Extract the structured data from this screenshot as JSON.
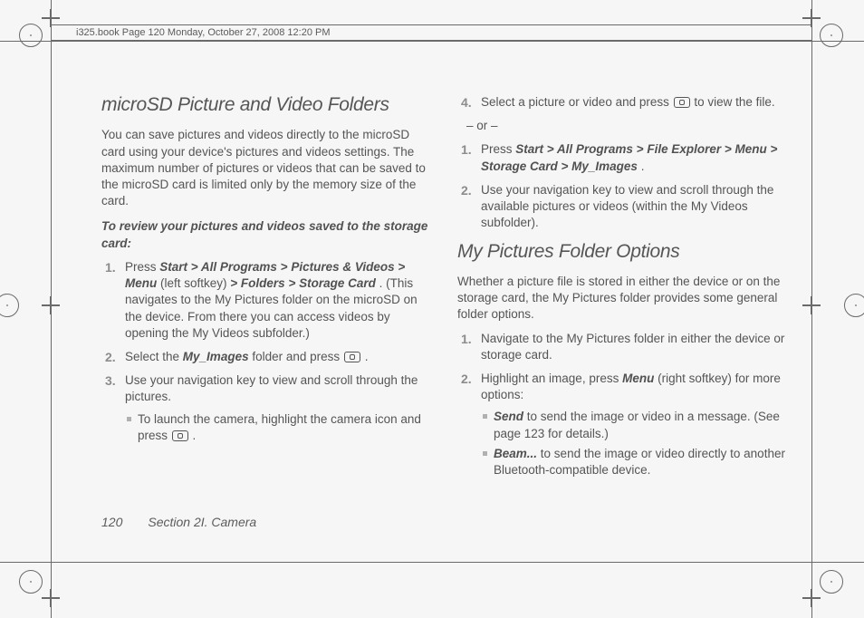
{
  "header": "i325.book  Page 120  Monday, October 27, 2008  12:20 PM",
  "left": {
    "h2": "microSD Picture and Video Folders",
    "intro": "You can save pictures and videos directly to the microSD card using your device's pictures and videos settings. The maximum number of pictures or videos that can be saved to the microSD card is limited only by the memory size of the card.",
    "sub": "To review your pictures and videos saved to the storage card:",
    "li1_a": "Press ",
    "li1_path": "Start > All Programs > Pictures & Videos > Menu",
    "li1_b": " (left softkey) ",
    "li1_path2": "> Folders > Storage Card",
    "li1_c": ". (This navigates to the My Pictures folder on the microSD on the device. From there you can access videos by opening the My Videos subfolder.)",
    "li2_a": "Select the ",
    "li2_em": "My_Images",
    "li2_b": " folder and press ",
    "li2_c": ".",
    "li3": "Use your navigation key to view and scroll through the pictures.",
    "li3_sub_a": "To launch the camera, highlight the camera icon and press ",
    "li3_sub_b": "."
  },
  "right": {
    "li4_a": "Select a picture or video and press ",
    "li4_b": " to view the file.",
    "or": "– or –",
    "li1_a": "Press ",
    "li1_path": "Start > All Programs > File Explorer > Menu > Storage Card > My_Images",
    "li1_b": ".",
    "li2": "Use your navigation key to view and scroll through the available pictures or videos (within the My Videos subfolder).",
    "h2": "My Pictures Folder Options",
    "intro": "Whether a picture file is stored in either the device or on the storage card, the My Pictures folder provides some general folder options.",
    "b_li1": "Navigate to the My Pictures folder in either the device or storage card.",
    "b_li2_a": "Highlight an image, press ",
    "b_li2_em": "Menu",
    "b_li2_b": " (right softkey) for more options:",
    "sb1_em": "Send",
    "sb1": " to send the image or video in a message. (See page 123 for details.)",
    "sb2_em": "Beam...",
    "sb2": " to send the image or video directly to another Bluetooth-compatible device."
  },
  "footer": {
    "page": "120",
    "section": "Section 2I. Camera"
  }
}
